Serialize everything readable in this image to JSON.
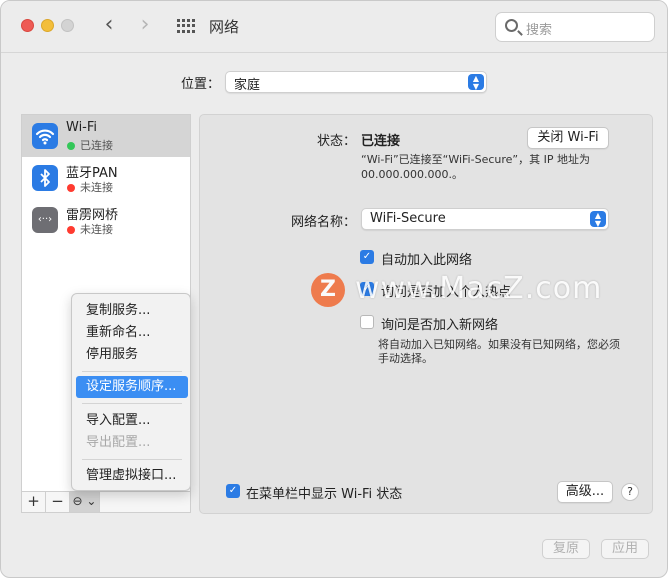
{
  "window": {
    "title": "网络"
  },
  "search": {
    "placeholder": "搜索"
  },
  "location": {
    "label": "位置：",
    "value": "家庭"
  },
  "services": [
    {
      "name": "Wi-Fi",
      "status": "已连接",
      "status_color": "#34c759"
    },
    {
      "name": "蓝牙PAN",
      "status": "未连接",
      "status_color": "#ff3b30"
    },
    {
      "name": "雷雳网桥",
      "status": "未连接",
      "status_color": "#ff3b30"
    }
  ],
  "sidebar_buttons": {
    "add": "+",
    "remove": "−",
    "action": "⊖ ⌄"
  },
  "context_menu": {
    "items": [
      {
        "label": "复制服务...",
        "state": "normal"
      },
      {
        "label": "重新命名...",
        "state": "normal"
      },
      {
        "label": "停用服务",
        "state": "normal"
      },
      {
        "label": "设定服务顺序...",
        "state": "highlighted"
      },
      {
        "label": "导入配置...",
        "state": "normal"
      },
      {
        "label": "导出配置...",
        "state": "disabled"
      },
      {
        "label": "管理虚拟接口...",
        "state": "normal"
      }
    ]
  },
  "detail": {
    "status_label": "状态：",
    "status_value": "已连接",
    "wifi_off_button": "关闭 Wi-Fi",
    "status_desc_line1": "“Wi-Fi”已连接至“WiFi-Secure”，其 IP 地址为",
    "status_desc_line2": "00.000.000.000.。",
    "network_name_label": "网络名称：",
    "network_name_value": "WiFi-Secure",
    "checkbox_auto_join": {
      "label": "自动加入此网络",
      "checked": true
    },
    "checkbox_personal_hotspot": {
      "label": "询问是否加入个人热点",
      "checked": true
    },
    "checkbox_ask_new": {
      "label": "询问是否加入新网络",
      "checked": false
    },
    "ask_desc_line1": "将自动加入已知网络。如果没有已知网络，您必须",
    "ask_desc_line2": "手动选择。",
    "menubar_checkbox": {
      "label": "在菜单栏中显示 Wi-Fi 状态",
      "checked": true
    },
    "advanced_button": "高级...",
    "help_button": "?"
  },
  "footer": {
    "revert": "复原",
    "apply": "应用"
  },
  "watermark": {
    "text": "www.MacZ.com",
    "logo": "Z"
  },
  "accent_color": "#2b7be4"
}
